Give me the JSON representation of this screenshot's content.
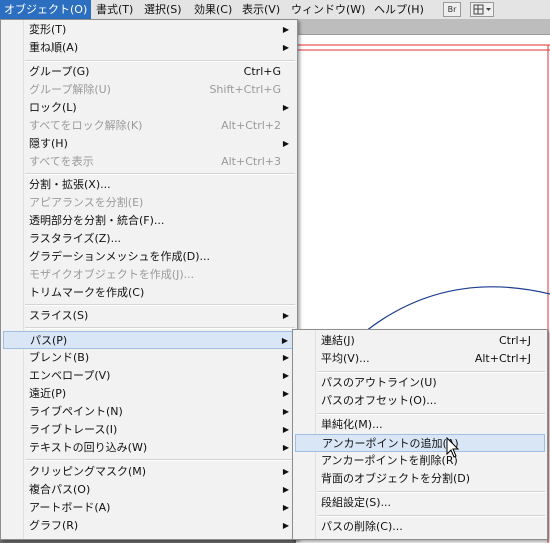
{
  "menubar": {
    "items": [
      "オブジェクト(O)",
      "書式(T)",
      "選択(S)",
      "効果(C)",
      "表示(V)",
      "ウィンドウ(W)",
      "ヘルプ(H)"
    ],
    "icons": [
      "Br",
      "grid-icon"
    ]
  },
  "object_menu": {
    "items": [
      {
        "label": "変形(T)",
        "submenu": true
      },
      {
        "label": "重ね順(A)",
        "submenu": true
      },
      {
        "label": "グループ(G)",
        "shortcut": "Ctrl+G"
      },
      {
        "label": "グループ解除(U)",
        "shortcut": "Shift+Ctrl+G",
        "disabled": true
      },
      {
        "label": "ロック(L)",
        "submenu": true
      },
      {
        "label": "すべてをロック解除(K)",
        "shortcut": "Alt+Ctrl+2",
        "disabled": true
      },
      {
        "label": "隠す(H)",
        "submenu": true
      },
      {
        "label": "すべてを表示",
        "shortcut": "Alt+Ctrl+3",
        "disabled": true
      },
      {
        "label": "分割・拡張(X)..."
      },
      {
        "label": "アピアランスを分割(E)",
        "disabled": true
      },
      {
        "label": "透明部分を分割・統合(F)..."
      },
      {
        "label": "ラスタライズ(Z)..."
      },
      {
        "label": "グラデーションメッシュを作成(D)..."
      },
      {
        "label": "モザイクオブジェクトを作成(J)...",
        "disabled": true
      },
      {
        "label": "トリムマークを作成(C)"
      },
      {
        "label": "スライス(S)",
        "submenu": true
      },
      {
        "label": "パス(P)",
        "submenu": true
      },
      {
        "label": "ブレンド(B)",
        "submenu": true
      },
      {
        "label": "エンベロープ(V)",
        "submenu": true
      },
      {
        "label": "遠近(P)",
        "submenu": true
      },
      {
        "label": "ライブペイント(N)",
        "submenu": true
      },
      {
        "label": "ライブトレース(I)",
        "submenu": true
      },
      {
        "label": "テキストの回り込み(W)",
        "submenu": true
      },
      {
        "label": "クリッピングマスク(M)",
        "submenu": true
      },
      {
        "label": "複合パス(O)",
        "submenu": true
      },
      {
        "label": "アートボード(A)",
        "submenu": true
      },
      {
        "label": "グラフ(R)",
        "submenu": true
      }
    ]
  },
  "path_submenu": {
    "items": [
      {
        "label": "連結(J)",
        "shortcut": "Ctrl+J"
      },
      {
        "label": "平均(V)...",
        "shortcut": "Alt+Ctrl+J"
      },
      {
        "label": "パスのアウトライン(U)"
      },
      {
        "label": "パスのオフセット(O)..."
      },
      {
        "label": "単純化(M)..."
      },
      {
        "label": "アンカーポイントの追加(A)"
      },
      {
        "label": "アンカーポイントを削除(R)"
      },
      {
        "label": "背面のオブジェクトを分割(D)"
      },
      {
        "label": "段組設定(S)..."
      },
      {
        "label": "パスの削除(C)..."
      }
    ]
  },
  "colors": {
    "accent": "#2c6ec0",
    "artboard_line": "#e03030",
    "path_stroke": "#1b3b8f"
  }
}
